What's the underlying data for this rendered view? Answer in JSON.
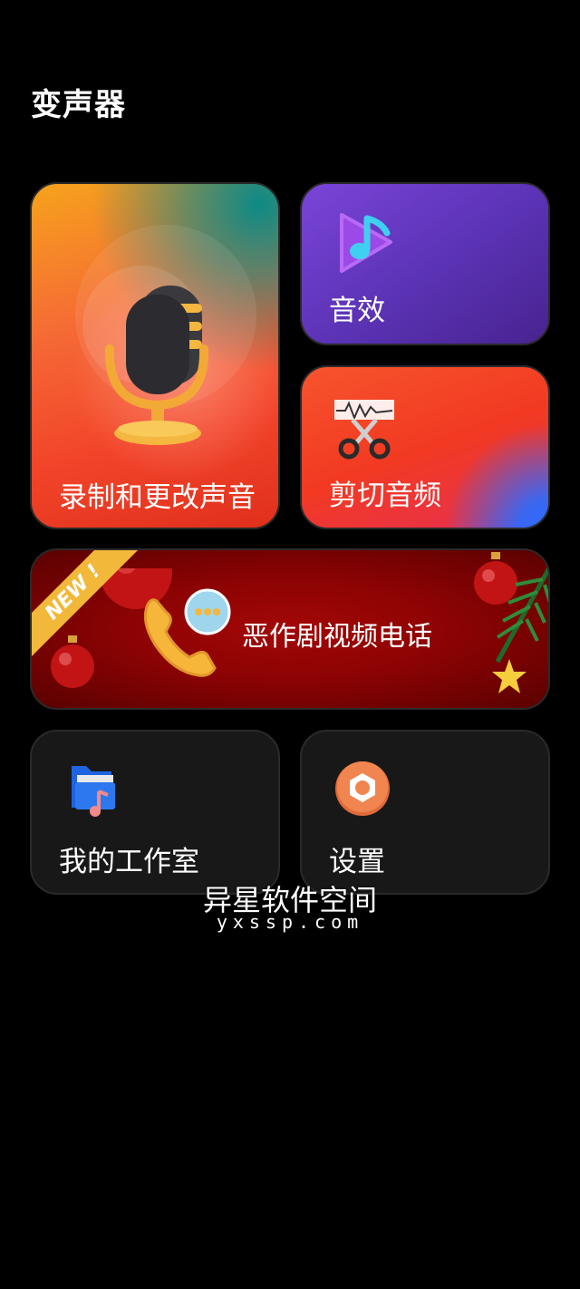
{
  "header": {
    "title": "变声器"
  },
  "cards": {
    "record": {
      "label": "录制和更改声音",
      "icon": "microphone-icon"
    },
    "effects": {
      "label": "音效",
      "icon": "music-note-icon"
    },
    "cut": {
      "label": "剪切音频",
      "icon": "scissors-waveform-icon"
    },
    "prank": {
      "label": "恶作剧视频电话",
      "badge": "NEW !",
      "icon": "phone-chat-icon"
    },
    "studio": {
      "label": "我的工作室",
      "icon": "music-folder-icon"
    },
    "settings": {
      "label": "设置",
      "icon": "gear-icon"
    }
  },
  "watermark": {
    "main": "异星软件空间",
    "sub": "yxssp.com"
  },
  "colors": {
    "background": "#000000",
    "effects_purple": "#5a32b4",
    "record_orange": "#f56a35",
    "cut_red": "#f23a22",
    "prank_red": "#a40707",
    "dark_card": "#181818",
    "ribbon_yellow": "#f2b83a"
  }
}
